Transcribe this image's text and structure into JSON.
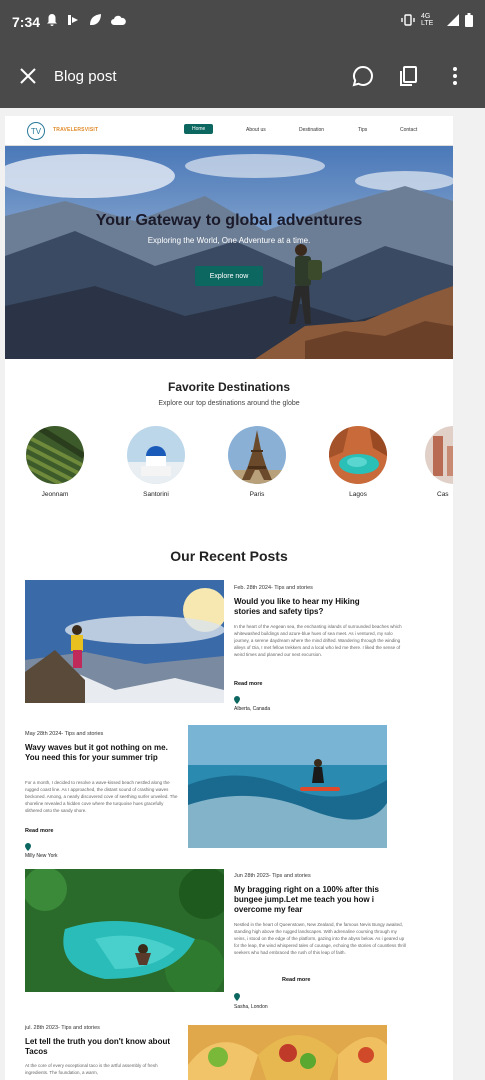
{
  "status_bar": {
    "time": "7:34",
    "network": "4G LTE"
  },
  "app_bar": {
    "title": "Blog post"
  },
  "site": {
    "brand": "TRAVELERSVISIT",
    "logo_mark": "TV",
    "nav": [
      "Home",
      "About us",
      "Destination",
      "Tips",
      "Contact"
    ],
    "active_nav": "Home"
  },
  "hero": {
    "title": "Your Gateway to global adventures",
    "subtitle": "Exploring the World, One Adventure at a time.",
    "button": "Explore now"
  },
  "destinations": {
    "title": "Favorite Destinations",
    "subtitle": "Explore our top destinations around the globe",
    "items": [
      "Jeonnam",
      "Santorini",
      "Paris",
      "Lagos",
      "Cas"
    ]
  },
  "posts_section": {
    "title": "Our Recent Posts"
  },
  "posts": [
    {
      "meta": "Feb. 28th 2024- Tips and stories",
      "title": "Would you like to hear my Hiking stories and safety tips?",
      "body": "In the heart of the Aegean sea, the enchanting islands of surrounded beaches which whitewashed buildings and azure-blue hues of sea meet. As i ventured, my solo journey, a serene daydream where the mind drifted. Wandering through the winding alleys of Oia, I met fellow trekkers and a local who led me there. I liked the sense of weird times and planned our next excursion.",
      "read_more": "Read more",
      "location": "Alberta, Canada"
    },
    {
      "meta": "May 28th 2024- Tips and stories",
      "title": "Wavy waves but it got nothing on me. You need this for your summer trip",
      "body": "For a month, I decided to resolve a wave-kissed beach nestled along the rugged coast line. As I approached, the distant sound of crashing waves beckoned. Among, a nearly discovered cove of seething surfer unveiled. The shoreline revealed a hidden cove where the turquoise hues gracefully slithered onto the sandy shore.",
      "read_more": "Read more",
      "location": "Milly New York"
    },
    {
      "meta": "Jun 28th 2023- Tips and stories",
      "title": "My bragging right on a 100% after this bungee jump.Let me teach you how i overcome my fear",
      "body": "Nestled in the heart of Queenstown, New Zealand, the famous Nevis Bungy awaited, standing high above the rugged landscapes. With adrenaline coursing through my veins, i stood on the edge of the platform, gazing into the abyss below. As i geared up for the leap, the wind whispered tales of courage, echoing the stories of countless thrill seekers who had embraced the rush of this leap of faith.",
      "read_more": "Read more",
      "location": "Sasha, London"
    },
    {
      "meta": "jul. 28th 2023- Tips and stories",
      "title": "Let tell the truth you don't know about Tacos",
      "body": "At the core of every exceptional taco is the artful assembly of fresh ingredients. The foundation, a warm,"
    }
  ]
}
